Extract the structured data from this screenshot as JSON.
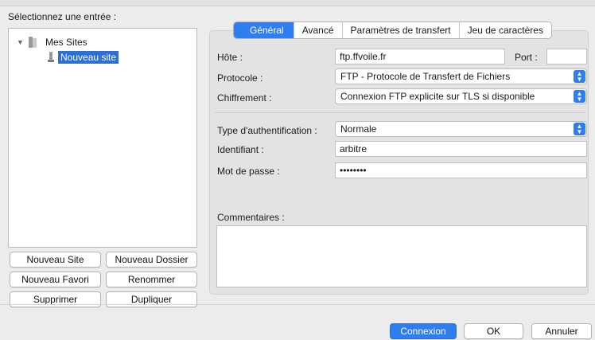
{
  "left": {
    "select_label": "Sélectionnez une entrée :",
    "tree": {
      "root_label": "Mes Sites",
      "child_label": "Nouveau site"
    },
    "buttons": {
      "new_site": "Nouveau Site",
      "new_folder": "Nouveau Dossier",
      "new_bookmark": "Nouveau Favori",
      "rename": "Renommer",
      "delete": "Supprimer",
      "duplicate": "Dupliquer"
    }
  },
  "tabs": [
    "Général",
    "Avancé",
    "Paramètres de transfert",
    "Jeu de caractères"
  ],
  "form": {
    "host_label": "Hôte :",
    "host_value": "ftp.ffvoile.fr",
    "port_label": "Port :",
    "port_value": "",
    "protocol_label": "Protocole :",
    "protocol_value": "FTP - Protocole de Transfert de Fichiers",
    "encryption_label": "Chiffrement :",
    "encryption_value": "Connexion FTP explicite sur TLS si disponible",
    "auth_label": "Type d'authentification :",
    "auth_value": "Normale",
    "user_label": "Identifiant :",
    "user_value": "arbitre",
    "password_label": "Mot de passe :",
    "password_value": "••••••••",
    "comments_label": "Commentaires :"
  },
  "footer": {
    "connect": "Connexion",
    "ok": "OK",
    "cancel": "Annuler"
  }
}
